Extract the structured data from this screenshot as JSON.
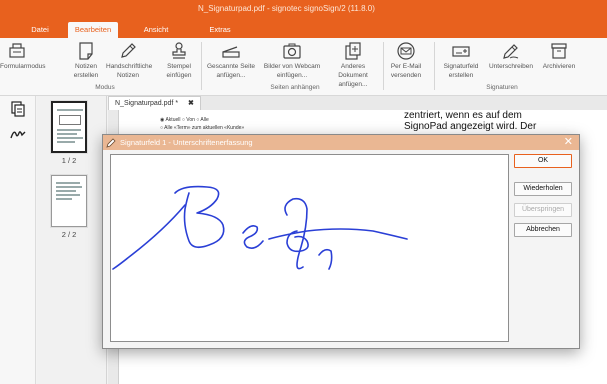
{
  "window": {
    "title": "N_Signaturpad.pdf - signotec signoSign/2 (11.8.0)"
  },
  "menu_tabs": [
    {
      "label": "Datei",
      "active": false
    },
    {
      "label": "Bearbeiten",
      "active": true
    },
    {
      "label": "Ansicht",
      "active": false
    },
    {
      "label": "Extras",
      "active": false
    }
  ],
  "ribbon": {
    "buttons": [
      {
        "label": "Formularmodus",
        "icon": "form-icon"
      },
      {
        "label": "Notizen erstellen",
        "icon": "note-icon"
      },
      {
        "label": "Handschriftliche Notizen",
        "icon": "pen-icon"
      },
      {
        "label": "Stempel einfügen",
        "icon": "stamp-icon"
      },
      {
        "label": "Gescannte Seite anfügen...",
        "icon": "scanner-icon"
      },
      {
        "label": "Bilder von Webcam einfügen...",
        "icon": "camera-icon"
      },
      {
        "label": "Anderes Dokument anfügen...",
        "icon": "add-document-icon"
      },
      {
        "label": "Per E-Mail versenden",
        "icon": "email-icon"
      },
      {
        "label": "Signaturfeld erstellen",
        "icon": "signature-field-icon"
      },
      {
        "label": "Unterschreiben",
        "icon": "sign-pen-icon"
      },
      {
        "label": "Archivieren",
        "icon": "archive-icon"
      }
    ],
    "groups": {
      "modus": "Modus",
      "seiten_anhaengen": "Seiten anhängen",
      "signaturen": "Signaturen"
    }
  },
  "thumbnails": [
    {
      "label": "1 / 2",
      "selected": true
    },
    {
      "label": "2 / 2",
      "selected": false
    }
  ],
  "document": {
    "tab_label": "N_Signaturpad.pdf *",
    "tab_close": "✖",
    "small_radio_line": "◉ Aktuell ○ Von ○ Alle",
    "small_option_line": "○ Alle «Term» zum aktuellen «Kunde»",
    "text_line_1": "zentriert, wenn es auf dem",
    "text_line_2": "SignoPad angezeigt wird. Der"
  },
  "dialog": {
    "title": "Signaturfeld 1 - Unterschriftenerfassung",
    "close": "✕",
    "buttons": {
      "ok": "OK",
      "repeat": "Wiederholen",
      "skip": "Überspringen",
      "cancel": "Abbrechen"
    }
  },
  "colors": {
    "accent": "#e8611e",
    "dialog_title": "#eab793",
    "ink": "#2a3fd6"
  }
}
